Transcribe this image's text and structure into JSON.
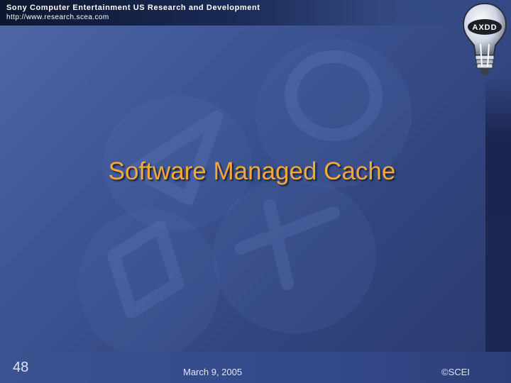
{
  "header": {
    "organization": "Sony Computer Entertainment US Research and Development",
    "url": "http://www.research.scea.com"
  },
  "logo": {
    "text": "AXDD",
    "icon": "light-bulb-icon"
  },
  "slide": {
    "title": "Software Managed Cache"
  },
  "footer": {
    "page_number": "48",
    "date": "March 9, 2005",
    "copyright": "©SCEI"
  },
  "colors": {
    "title": "#f2a93a",
    "background": "#3d5494",
    "header_bar": "#0d1730",
    "footer_text": "#dfe6f5"
  }
}
